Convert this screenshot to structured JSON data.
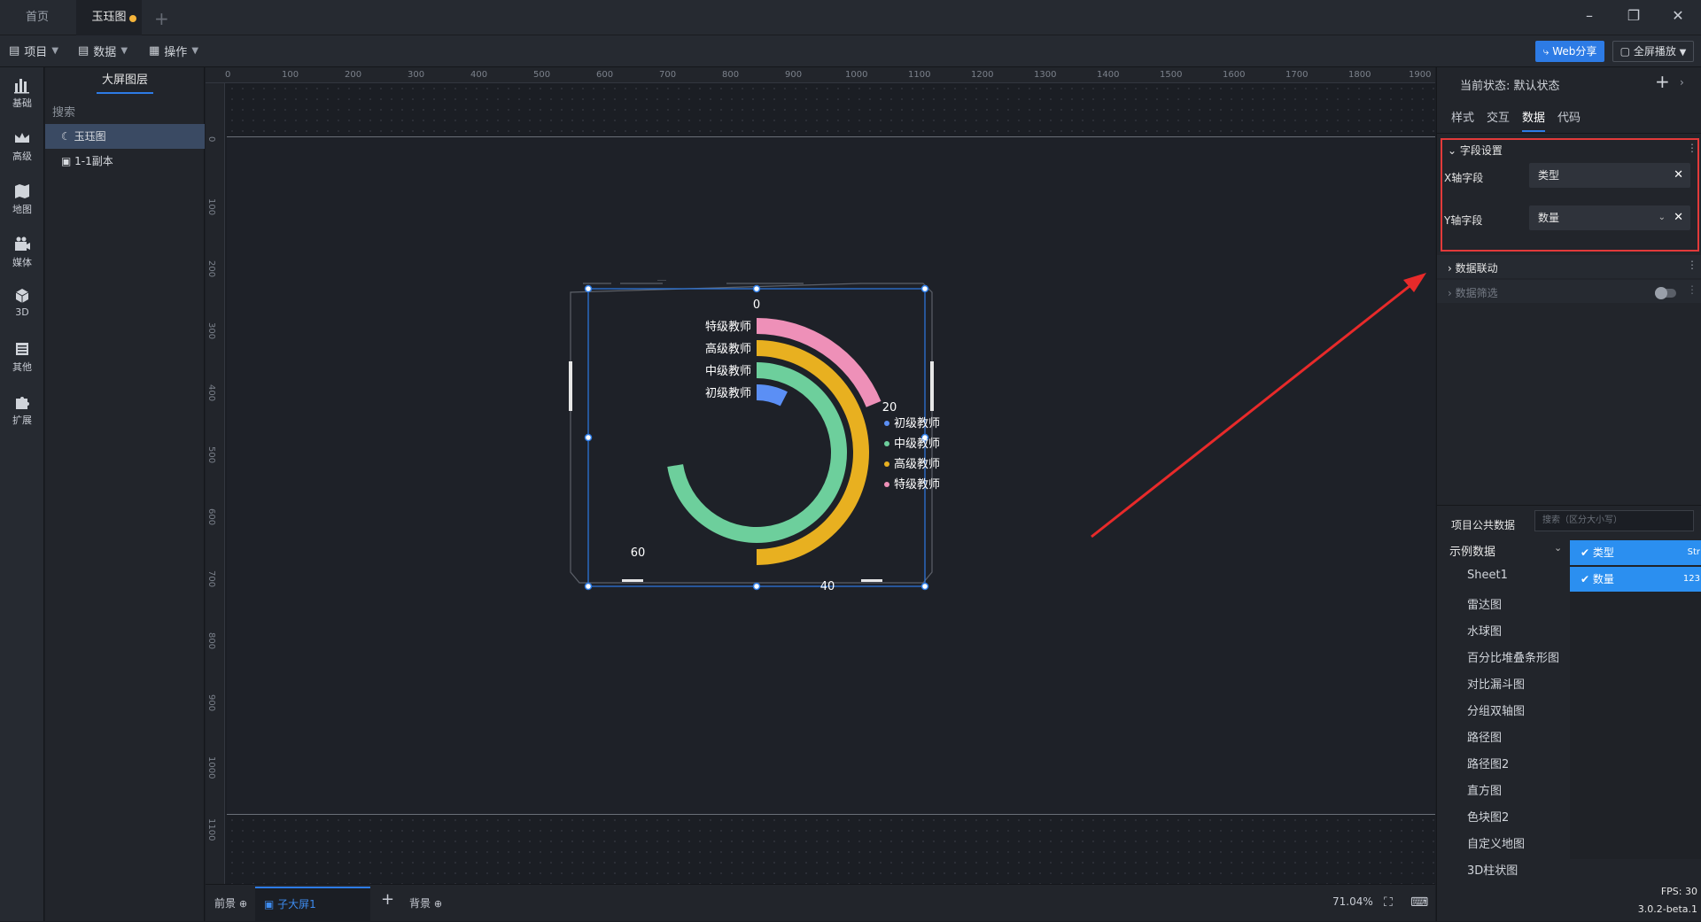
{
  "titlebar": {
    "tabs": [
      {
        "label": "首页"
      },
      {
        "label": "玉珏图"
      }
    ]
  },
  "toolbar": {
    "menus": [
      {
        "label": "项目"
      },
      {
        "label": "数据"
      },
      {
        "label": "操作"
      }
    ],
    "share_label": "Web分享",
    "fullscreen_label": "全屏播放"
  },
  "rail": {
    "items": [
      {
        "label": "基础",
        "icon": "bar-chart-icon"
      },
      {
        "label": "高级",
        "icon": "crown-icon"
      },
      {
        "label": "地图",
        "icon": "map-icon"
      },
      {
        "label": "媒体",
        "icon": "camera-icon"
      },
      {
        "label": "3D",
        "icon": "cube-icon"
      },
      {
        "label": "其他",
        "icon": "list-icon"
      },
      {
        "label": "扩展",
        "icon": "puzzle-icon"
      }
    ]
  },
  "layers": {
    "title": "大屏图层",
    "search_placeholder": "搜索",
    "items": [
      {
        "label": "玉珏图",
        "icon": "moon-icon",
        "selected": true
      },
      {
        "label": "1-1副本",
        "icon": "image-icon",
        "selected": false
      }
    ]
  },
  "canvas": {
    "ruler_top": [
      "0",
      "100",
      "200",
      "300",
      "400",
      "500",
      "600",
      "700",
      "800",
      "900",
      "1000",
      "1100",
      "1200",
      "1300",
      "1400",
      "1500",
      "1600",
      "1700",
      "1800",
      "1900"
    ],
    "ruler_left": [
      "0",
      "100",
      "200",
      "300",
      "400",
      "500",
      "600",
      "700",
      "800",
      "900",
      "1000",
      "1100"
    ]
  },
  "chart_data": {
    "type": "radial-bar",
    "max": 80,
    "categories": [
      "特级教师",
      "高级教师",
      "中级教师",
      "初级教师"
    ],
    "values": [
      15,
      40,
      58,
      6
    ],
    "colors": [
      "#ee90b8",
      "#e8b020",
      "#6dcf9c",
      "#5b8ff5"
    ],
    "ticks": [
      "0",
      "20",
      "40",
      "60"
    ],
    "legend": [
      "初级教师",
      "中级教师",
      "高级教师",
      "特级教师"
    ],
    "legend_colors": [
      "#5b8ff5",
      "#6dcf9c",
      "#e8b020",
      "#ee90b8"
    ]
  },
  "bottombar": {
    "foreground": "前景",
    "tab": "子大屏1",
    "background": "背景",
    "zoom": "71.04%"
  },
  "right": {
    "state_label": "当前状态:",
    "state_value": "默认状态",
    "tabs": [
      "样式",
      "交互",
      "数据",
      "代码"
    ],
    "active_tab": "数据",
    "field_settings": "字段设置",
    "x_label": "X轴字段",
    "x_value": "类型",
    "y_label": "Y轴字段",
    "y_value": "数量",
    "linkage": "数据联动",
    "filter": "数据筛选",
    "public_data": "项目公共数据",
    "public_search_placeholder": "搜索（区分大小写）",
    "dataset_head": "示例数据",
    "datasets": [
      "Sheet1",
      "雷达图",
      "水球图",
      "百分比堆叠条形图",
      "对比漏斗图",
      "分组双轴图",
      "路径图",
      "路径图2",
      "直方图",
      "色块图2",
      "自定义地图",
      "3D柱状图"
    ],
    "fields": [
      {
        "label": "类型",
        "type": "Str"
      },
      {
        "label": "数量",
        "type": "123"
      }
    ]
  },
  "status": {
    "fps": "FPS: 30",
    "version": "3.0.2-beta.1"
  }
}
